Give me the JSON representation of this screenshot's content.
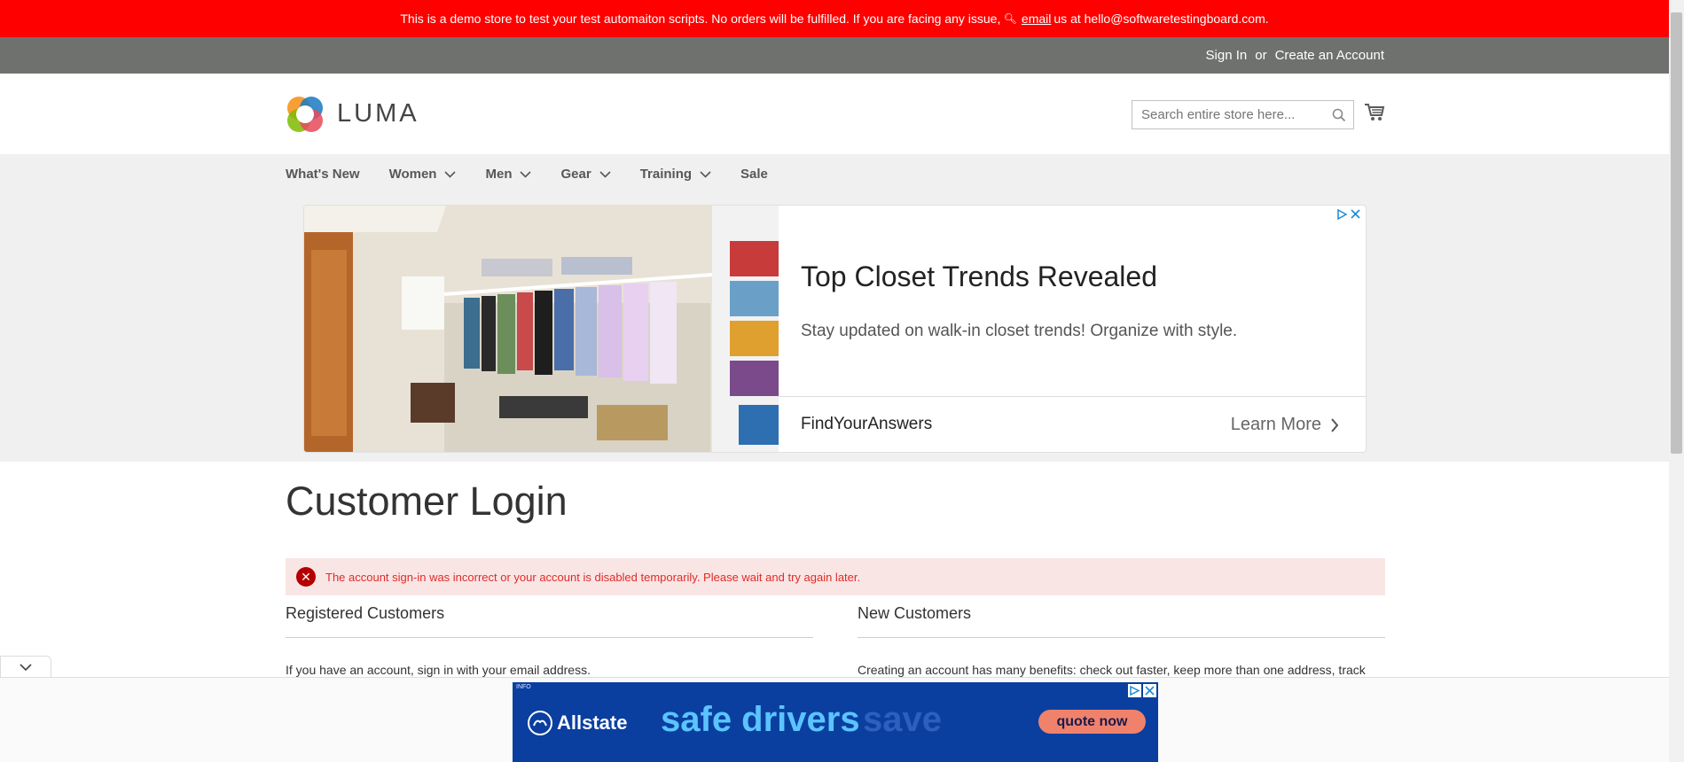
{
  "demo_notice": {
    "text_before": "This is a demo store to test your test automaiton scripts. No orders will be fulfilled. If you are facing any issue,",
    "link": "email",
    "text_after": "us at hello@softwaretestingboard.com."
  },
  "account": {
    "sign_in": "Sign In",
    "or": "or",
    "create": "Create an Account"
  },
  "logo": {
    "text": "LUMA"
  },
  "search": {
    "placeholder": "Search entire store here..."
  },
  "nav": {
    "items": [
      {
        "label": "What's New"
      },
      {
        "label": "Women"
      },
      {
        "label": "Men"
      },
      {
        "label": "Gear"
      },
      {
        "label": "Training"
      },
      {
        "label": "Sale"
      }
    ]
  },
  "ad": {
    "title": "Top Closet Trends Revealed",
    "description": "Stay updated on walk-in closet trends! Organize with style.",
    "brand": "FindYourAnswers",
    "cta": "Learn More"
  },
  "page": {
    "title": "Customer Login"
  },
  "error": {
    "message": "The account sign-in was incorrect or your account is disabled temporarily. Please wait and try again later."
  },
  "registered": {
    "title": "Registered Customers",
    "text": "If you have an account, sign in with your email address."
  },
  "new_customers": {
    "title": "New Customers",
    "text": "Creating an account has many benefits: check out faster, keep more than one address, track orders and more."
  },
  "bottom_ad": {
    "info": "INFO",
    "brand": "Allstate",
    "headline": "safe drivers",
    "ghost": "save",
    "cta": "quote now"
  },
  "colors": {
    "demo_bar": "#ff0000",
    "account_bar": "#6e716e",
    "error_bg": "#fae5e5",
    "error_text": "#e02b27",
    "allstate_blue": "#0a3fa0"
  }
}
